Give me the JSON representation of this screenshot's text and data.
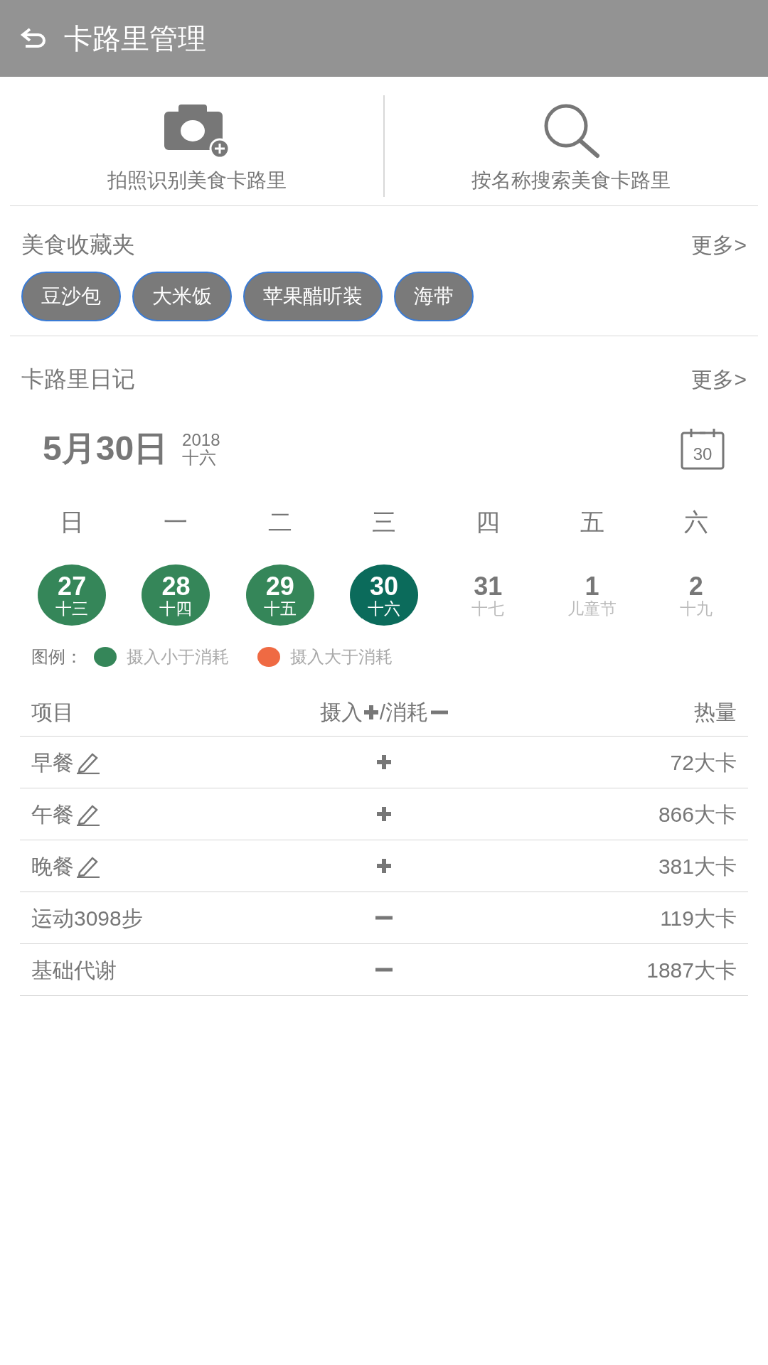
{
  "header": {
    "title": "卡路里管理"
  },
  "actions": [
    {
      "kind": "camera",
      "label": "拍照识别美食卡路里"
    },
    {
      "kind": "search",
      "label": "按名称搜索美食卡路里"
    }
  ],
  "favorites": {
    "title": "美食收藏夹",
    "more": "更多>",
    "items": [
      "豆沙包",
      "大米饭",
      "苹果醋听装",
      "海带"
    ]
  },
  "diary": {
    "title": "卡路里日记",
    "more": "更多>",
    "date": "5月30日",
    "year": "2018",
    "lunar": "十六",
    "calendar_icon_day": "30",
    "weekdays": [
      "日",
      "一",
      "二",
      "三",
      "四",
      "五",
      "六"
    ],
    "days": [
      {
        "day": "27",
        "lunar": "十三",
        "color": "#358659"
      },
      {
        "day": "28",
        "lunar": "十四",
        "color": "#358659"
      },
      {
        "day": "29",
        "lunar": "十五",
        "color": "#358659"
      },
      {
        "day": "30",
        "lunar": "十六",
        "color": "#0b6b5b"
      },
      {
        "day": "31",
        "lunar": "十七"
      },
      {
        "day": "1",
        "lunar": "儿童节"
      },
      {
        "day": "2",
        "lunar": "十九"
      }
    ],
    "legend": {
      "label": "图例：",
      "items": [
        {
          "label": "摄入小于消耗",
          "color": "#358659"
        },
        {
          "label": "摄入大于消耗",
          "color": "#ef6a43"
        }
      ]
    }
  },
  "table": {
    "columns": {
      "item": "项目",
      "intake": "摄入",
      "burn": "/消耗",
      "calories": "热量"
    },
    "rows": [
      {
        "item": "早餐",
        "editable": true,
        "kind": "intake",
        "calories": "72大卡"
      },
      {
        "item": "午餐",
        "editable": true,
        "kind": "intake",
        "calories": "866大卡"
      },
      {
        "item": "晚餐",
        "editable": true,
        "kind": "intake",
        "calories": "381大卡"
      },
      {
        "item": "运动3098步",
        "editable": false,
        "kind": "burn",
        "calories": "119大卡"
      },
      {
        "item": "基础代谢",
        "editable": false,
        "kind": "burn",
        "calories": "1887大卡"
      }
    ]
  }
}
